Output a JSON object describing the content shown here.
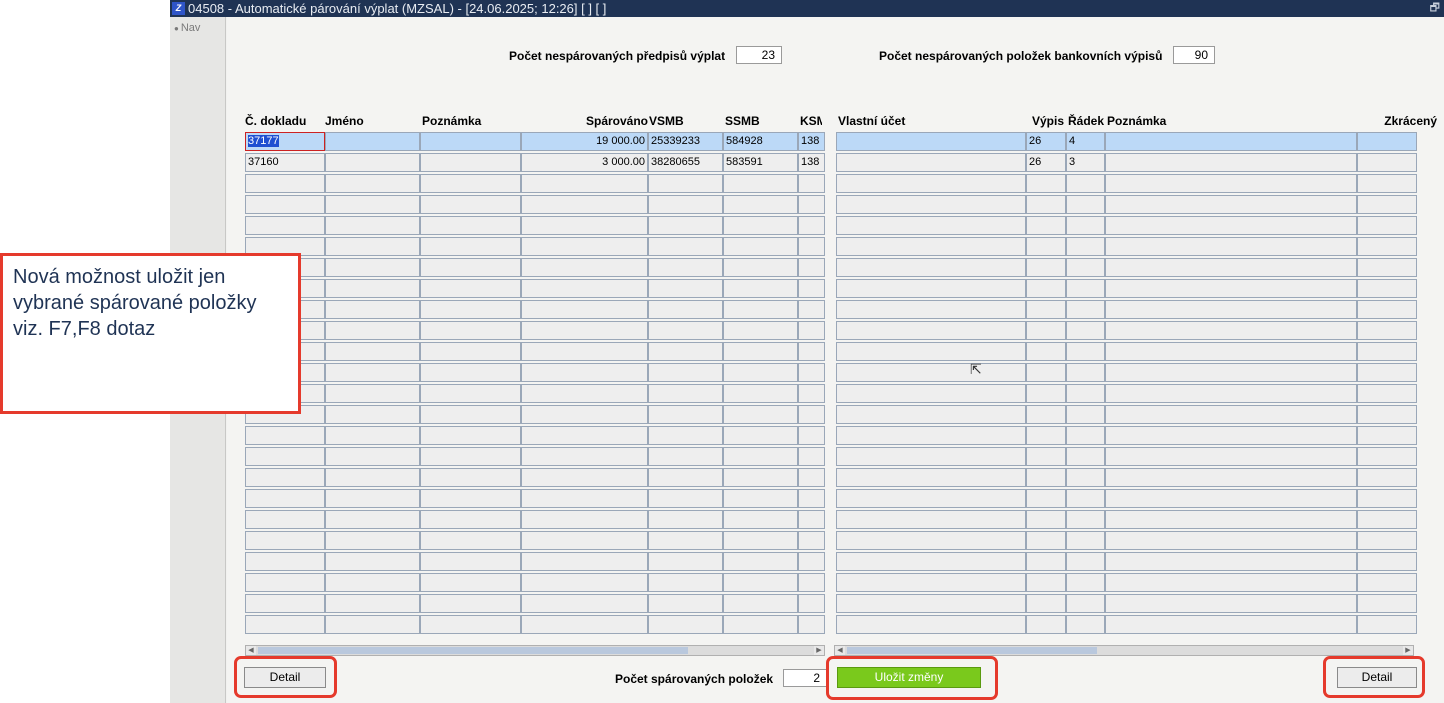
{
  "window": {
    "title": "04508 - Automatické párování výplat (MZSAL) - [24.06.2025; 12:26]  [ ]  [ ]"
  },
  "nav": {
    "label": "Nav"
  },
  "summary": {
    "unmatched_prescriptions_label": "Počet nespárovaných předpisů výplat",
    "unmatched_prescriptions_value": "23",
    "unmatched_bank_label": "Počet nespárovaných položek bankovních výpisů",
    "unmatched_bank_value": "90",
    "matched_count_label": "Počet spárovaných položek",
    "matched_count_value": "2"
  },
  "left_table": {
    "headers": [
      "Č. dokladu",
      "Jméno",
      "Poznámka",
      "Spárováno",
      "VSMB",
      "SSMB",
      "KSM"
    ],
    "rows": [
      [
        "37177",
        "",
        "",
        "19 000.00",
        "25339233",
        "584928",
        "138"
      ],
      [
        "37160",
        "",
        "",
        "3 000.00",
        "38280655",
        "583591",
        "138"
      ]
    ]
  },
  "right_table": {
    "headers": [
      "Vlastní účet",
      "Výpis",
      "Řádek",
      "Poznámka",
      "Zkrácený"
    ],
    "rows": [
      [
        "",
        "26",
        "4",
        "",
        ""
      ],
      [
        "",
        "26",
        "3",
        "",
        ""
      ]
    ]
  },
  "buttons": {
    "detail_left": "Detail",
    "save_changes": "Uložit změny",
    "detail_right": "Detail"
  },
  "callout": {
    "text": "Nová možnost uložit jen vybrané spárované položky viz. F7,F8 dotaz"
  },
  "colors": {
    "titlebar": "#1f3354",
    "save_button": "#7ac91c",
    "highlight_frame": "#e53a2c",
    "selected_row": "#bcd9f7"
  }
}
